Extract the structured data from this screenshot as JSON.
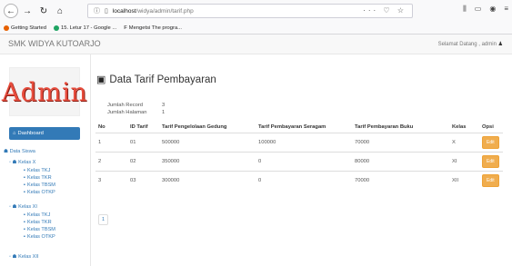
{
  "browser": {
    "url_host": "localhost",
    "url_path": "/widya/admin/tarif.php",
    "bookmarks": [
      "Getting Started",
      "15. Letur 17 - Google ...",
      "Mengetsi The progra..."
    ]
  },
  "navbar": {
    "brand": "SMK WIDYA KUTOARJO",
    "greeting": "Selamat Datang , admin"
  },
  "sidebar": {
    "logo_text": "Admin",
    "dashboard": "Dashboard",
    "data_siswa": "Data Siswa",
    "groups": [
      {
        "label": "Kelas X",
        "items": [
          "Kelas TKJ",
          "Kelas TKR",
          "Kelas TBSM",
          "Kelas OTKP"
        ]
      },
      {
        "label": "Kelas XI",
        "items": [
          "Kelas TKJ",
          "Kelas TKR",
          "Kelas TBSM",
          "Kelas OTKP"
        ]
      },
      {
        "label": "Kelas XII",
        "items": []
      }
    ]
  },
  "page": {
    "title": "Data Tarif Pembayaran",
    "jumlah_record_label": "Jumlah Record",
    "jumlah_record_value": "3",
    "jumlah_halaman_label": "Jumlah Halaman",
    "jumlah_halaman_value": "1",
    "columns": [
      "No",
      "ID Tarif",
      "Tarif Pengelolaan Gedung",
      "Tarif Pembayaran Seragam",
      "Tarif Pembayaran Buku",
      "Kelas",
      "Opsi"
    ],
    "rows": [
      {
        "no": "1",
        "id": "01",
        "gedung": "500000",
        "seragam": "100000",
        "buku": "70000",
        "kelas": "X"
      },
      {
        "no": "2",
        "id": "02",
        "gedung": "350000",
        "seragam": "0",
        "buku": "80000",
        "kelas": "XI"
      },
      {
        "no": "3",
        "id": "03",
        "gedung": "300000",
        "seragam": "0",
        "buku": "70000",
        "kelas": "XII"
      }
    ],
    "edit_label": "Edit",
    "pager": "1"
  }
}
